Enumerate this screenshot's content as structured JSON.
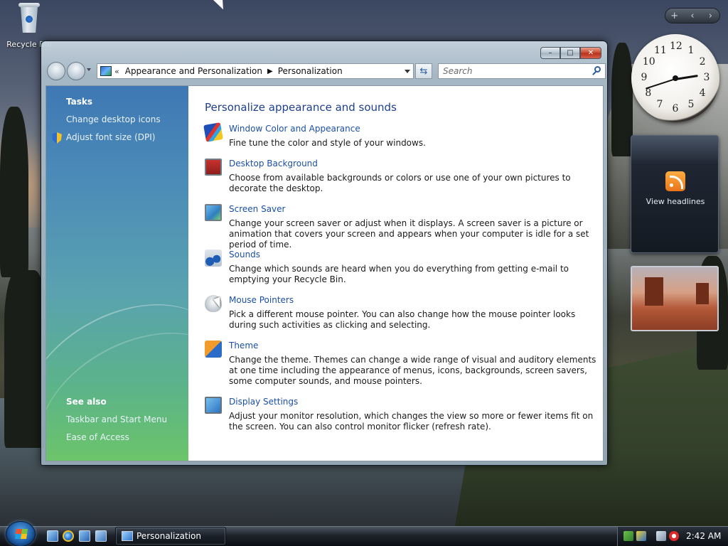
{
  "desktop": {
    "recycle_bin_label": "Recycle Bin"
  },
  "gadgets": {
    "controls": [
      "+",
      "‹",
      "›"
    ],
    "clock_numbers": [
      "12",
      "1",
      "2",
      "3",
      "4",
      "5",
      "6",
      "7",
      "8",
      "9",
      "10",
      "11"
    ],
    "clock_time": {
      "hour": 2,
      "minute": 42
    },
    "rss_label": "View headlines"
  },
  "window": {
    "title": "Personalization",
    "caption_buttons": {
      "minimize": "–",
      "maximize": "□",
      "close": "✕"
    },
    "address": {
      "overflow": "«",
      "crumbs": [
        "Appearance and Personalization",
        "Personalization"
      ]
    },
    "search_placeholder": "Search",
    "tasks": {
      "heading": "Tasks",
      "links": [
        "Change desktop icons",
        "Adjust font size (DPI)"
      ]
    },
    "see_also": {
      "heading": "See also",
      "links": [
        "Taskbar and Start Menu",
        "Ease of Access"
      ]
    },
    "main": {
      "heading": "Personalize appearance and sounds",
      "items": [
        {
          "icon": "color-appearance-icon",
          "title": "Window Color and Appearance",
          "desc": "Fine tune the color and style of your windows."
        },
        {
          "icon": "desktop-background-icon",
          "title": "Desktop Background",
          "desc": "Choose from available backgrounds or colors or use one of your own pictures to decorate the desktop."
        },
        {
          "icon": "screen-saver-icon",
          "title": "Screen Saver",
          "desc": "Change your screen saver or adjust when it displays. A screen saver is a picture or animation that covers your screen and appears when your computer is idle for a set period of time."
        },
        {
          "icon": "sounds-icon",
          "title": "Sounds",
          "desc": "Change which sounds are heard when you do everything from getting e-mail to emptying your Recycle Bin."
        },
        {
          "icon": "mouse-pointers-icon",
          "title": "Mouse Pointers",
          "desc": "Pick a different mouse pointer. You can also change how the mouse pointer looks during such activities as clicking and selecting."
        },
        {
          "icon": "theme-icon",
          "title": "Theme",
          "desc": "Change the theme. Themes can change a wide range of visual and auditory elements at one time including the appearance of menus, icons, backgrounds, screen savers, some computer sounds, and mouse pointers."
        },
        {
          "icon": "display-settings-icon",
          "title": "Display Settings",
          "desc": "Adjust your monitor resolution, which changes the view so more or fewer items fit on the screen. You can also control monitor flicker (refresh rate)."
        }
      ]
    }
  },
  "taskbar": {
    "task_label": "Personalization",
    "clock": "2:42 AM"
  },
  "colors": {
    "link_blue": "#1b4fa8",
    "heading_blue": "#1e3f8f",
    "pane_top": "#3f78b4",
    "pane_bottom": "#6cc46a"
  }
}
